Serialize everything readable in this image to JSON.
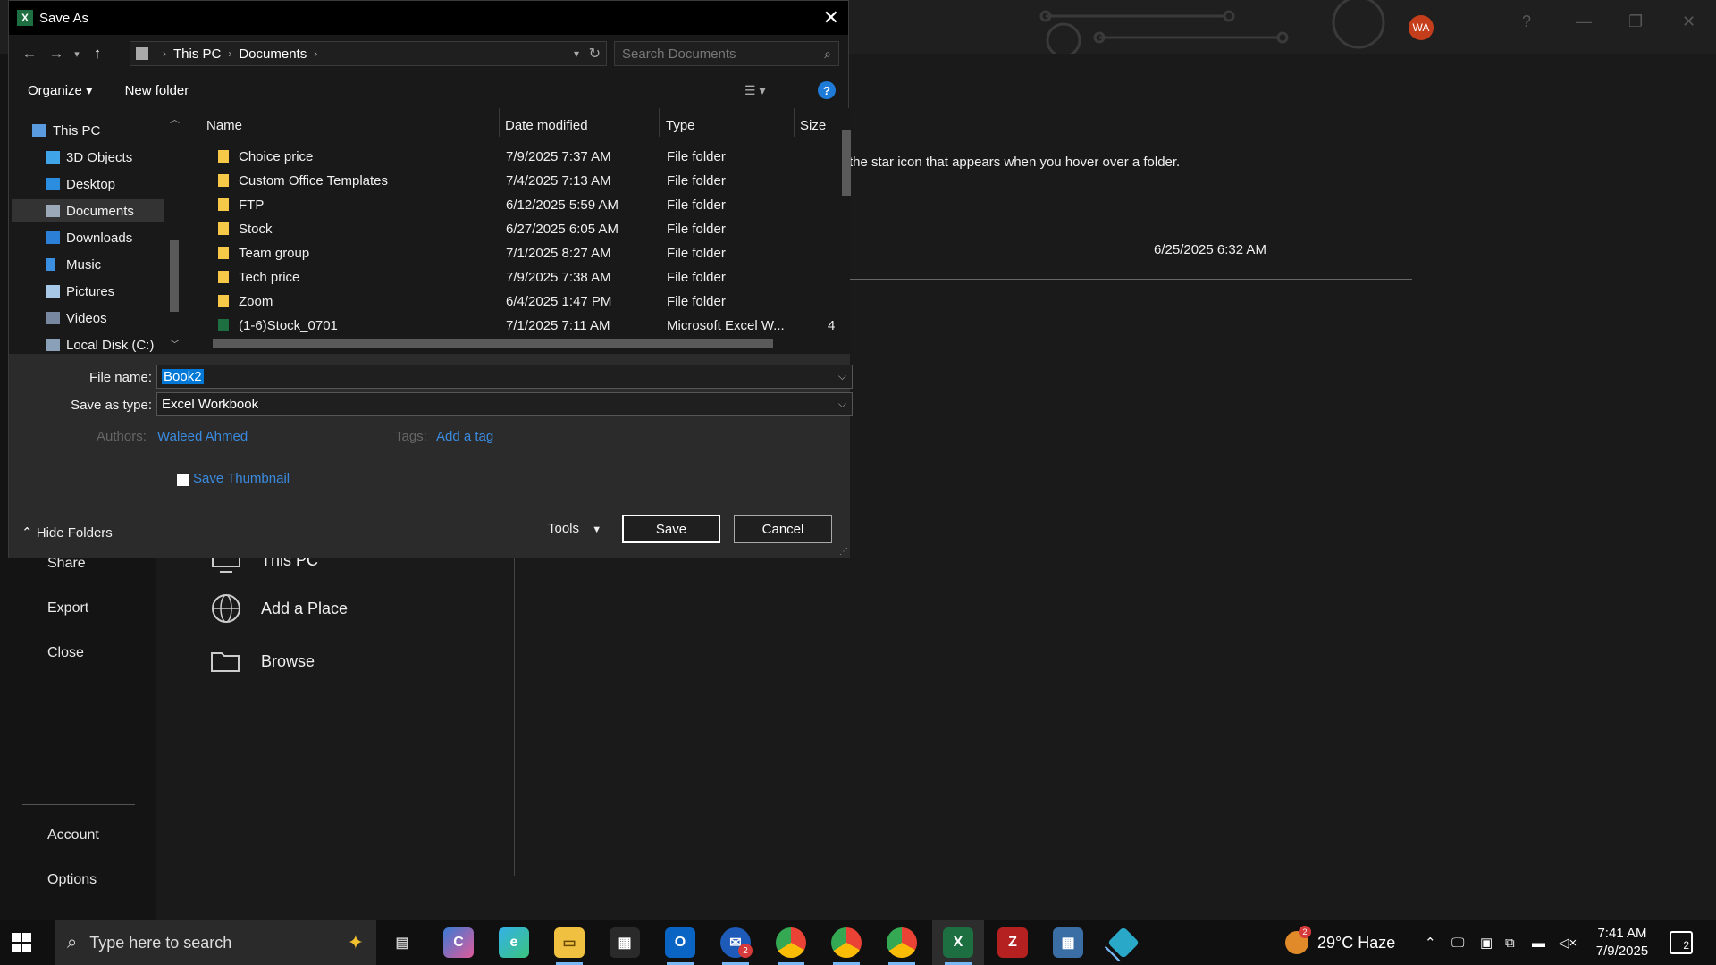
{
  "dialog": {
    "title": "Save As",
    "address": {
      "crumbs": [
        "This PC",
        "Documents"
      ]
    },
    "search_placeholder": "Search Documents",
    "toolbar": {
      "organize": "Organize ▾",
      "new_folder": "New folder",
      "help": "?"
    },
    "nav": [
      "This PC",
      "3D Objects",
      "Desktop",
      "Documents",
      "Downloads",
      "Music",
      "Pictures",
      "Videos",
      "Local Disk (C:)"
    ],
    "columns": {
      "name": "Name",
      "date": "Date modified",
      "type": "Type",
      "size": "Size"
    },
    "files": [
      {
        "name": "Choice price",
        "date": "7/9/2025 7:37 AM",
        "type": "File folder",
        "size": ""
      },
      {
        "name": "Custom Office Templates",
        "date": "7/4/2025 7:13 AM",
        "type": "File folder",
        "size": ""
      },
      {
        "name": "FTP",
        "date": "6/12/2025 5:59 AM",
        "type": "File folder",
        "size": ""
      },
      {
        "name": "Stock",
        "date": "6/27/2025 6:05 AM",
        "type": "File folder",
        "size": ""
      },
      {
        "name": "Team group",
        "date": "7/1/2025 8:27 AM",
        "type": "File folder",
        "size": ""
      },
      {
        "name": "Tech price",
        "date": "7/9/2025 7:38 AM",
        "type": "File folder",
        "size": ""
      },
      {
        "name": "Zoom",
        "date": "6/4/2025 1:47 PM",
        "type": "File folder",
        "size": ""
      },
      {
        "name": "(1-6)Stock_0701",
        "date": "7/1/2025 7:11 AM",
        "type": "Microsoft Excel W...",
        "size": "4"
      }
    ],
    "form": {
      "file_name_label": "File name:",
      "file_name_value": "Book2",
      "save_type_label": "Save as type:",
      "save_type_value": "Excel Workbook",
      "authors_label": "Authors:",
      "authors_value": "Waleed Ahmed",
      "tags_label": "Tags:",
      "tags_value": "Add a tag",
      "thumbnail_label": "Save Thumbnail"
    },
    "hide_folders": "Hide Folders",
    "tools": "Tools",
    "save": "Save",
    "cancel": "Cancel"
  },
  "background": {
    "avatar": "WA",
    "left_menu": [
      "Share",
      "Export",
      "Close"
    ],
    "bottom_menu": [
      "Account",
      "Options"
    ],
    "places": {
      "this_pc": "This PC",
      "add_place": "Add a Place",
      "browse": "Browse"
    },
    "hint": "the star icon that appears when you hover over a folder.",
    "date": "6/25/2025 6:32 AM"
  },
  "taskbar": {
    "search_placeholder": "Type here to search",
    "weather": "29°C  Haze",
    "time": "7:41 AM",
    "date": "7/9/2025",
    "notifications": "2",
    "mail_badge": "2",
    "weather_badge": "2"
  },
  "colors": {
    "accent": "#0078d7",
    "link": "#3a8be0",
    "excel": "#1d6f42",
    "folder": "#f5c848"
  },
  "icons": [
    "excel-icon",
    "close-icon",
    "back-icon",
    "forward-icon",
    "up-icon",
    "refresh-icon",
    "search-icon",
    "help-icon",
    "folder-icon",
    "windows-start-icon",
    "chevron-down-icon"
  ]
}
